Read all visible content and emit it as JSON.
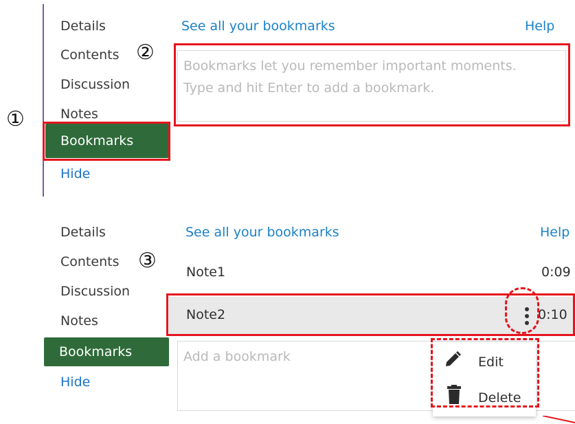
{
  "top": {
    "nav": [
      "Details",
      "Contents",
      "Discussion",
      "Notes",
      "Bookmarks",
      "Hide"
    ],
    "see_all": "See all your bookmarks",
    "help": "Help",
    "placeholder_line1": "Bookmarks let you remember important moments.",
    "placeholder_line2": "Type and hit Enter to add a bookmark."
  },
  "bottom": {
    "nav": [
      "Details",
      "Contents",
      "Discussion",
      "Notes",
      "Bookmarks",
      "Hide"
    ],
    "see_all": "See all your bookmarks",
    "help": "Help",
    "bookmarks": [
      {
        "label": "Note1",
        "time": "0:09"
      },
      {
        "label": "Note2",
        "time": "0:10"
      }
    ],
    "add_placeholder": "Add a bookmark",
    "menu": {
      "edit": "Edit",
      "delete": "Delete"
    }
  },
  "markers": {
    "one": "①",
    "two": "②",
    "three": "③"
  },
  "colors": {
    "accent_green": "#2f6b3a",
    "link_blue": "#1b82c8",
    "highlight_red": "#e5141c"
  }
}
